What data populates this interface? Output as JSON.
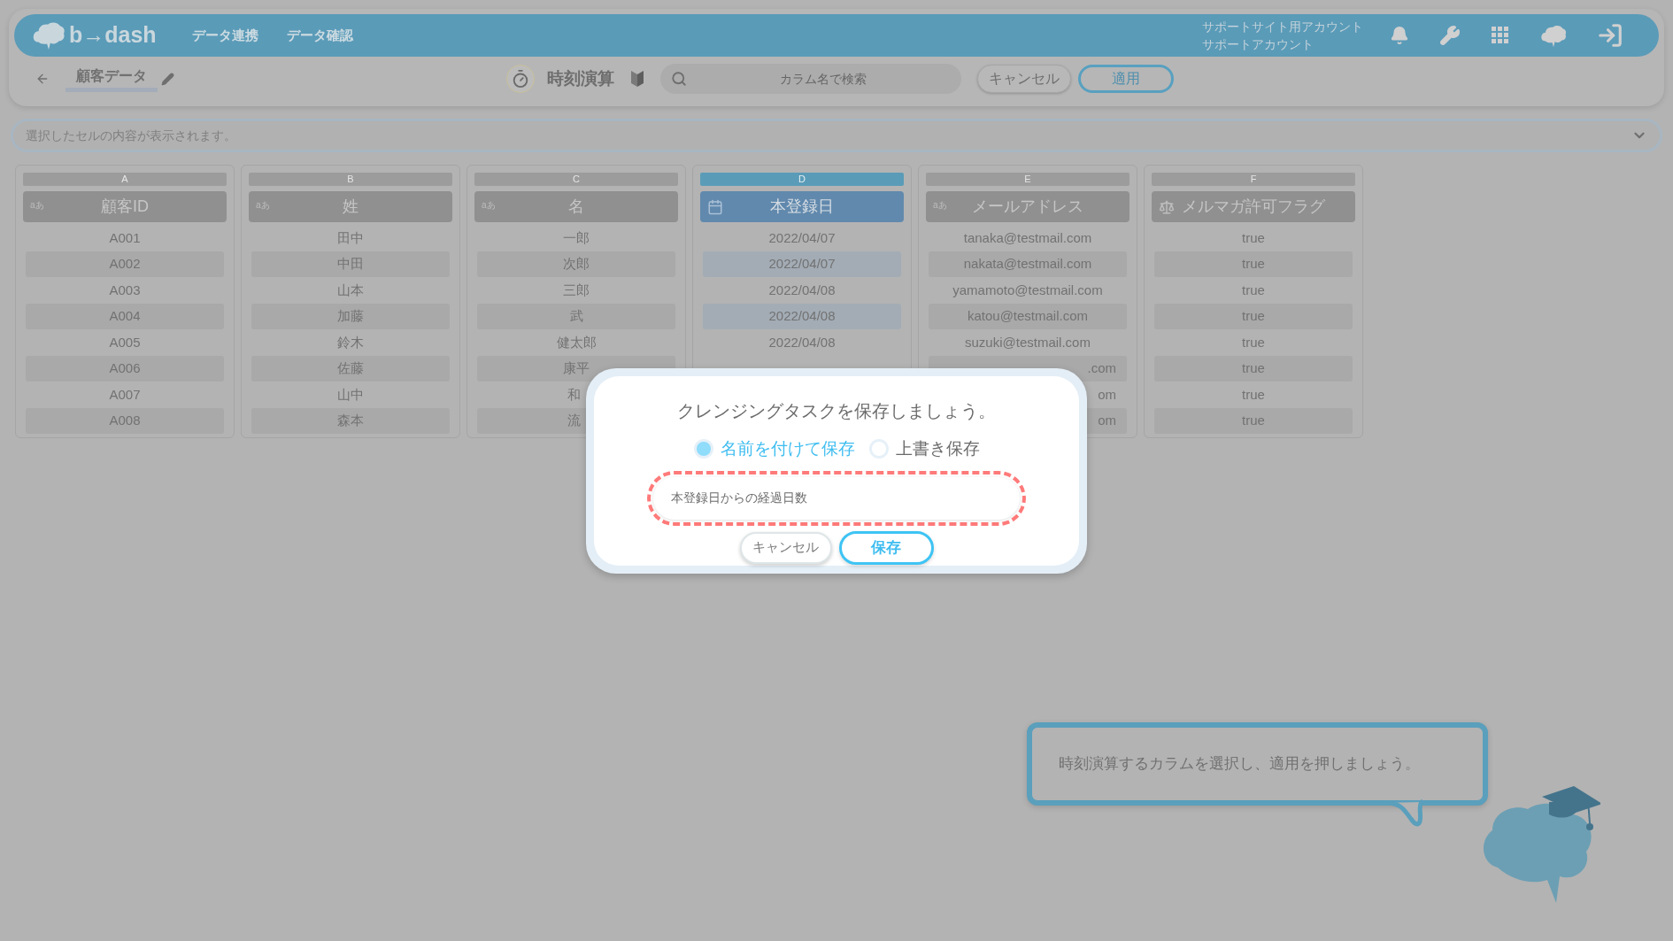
{
  "header": {
    "logo": "b→dash",
    "nav": [
      "データ連携",
      "データ確認"
    ],
    "account": [
      "サポートサイト用アカウント",
      "サポートアカウント"
    ]
  },
  "toolbar": {
    "dataset": "顧客データ",
    "mode": "時刻演算",
    "search": {
      "placeholder": "カラム名で検索"
    },
    "cancel": "キャンセル",
    "apply": "適用"
  },
  "cell_bar": {
    "placeholder": "選択したセルの内容が表示されます。"
  },
  "table": {
    "columns": [
      {
        "letter": "A",
        "name": "顧客ID",
        "kind": "text",
        "type_label": "aあ",
        "selected": false,
        "cells": [
          "A001",
          "A002",
          "A003",
          "A004",
          "A005",
          "A006",
          "A007",
          "A008"
        ]
      },
      {
        "letter": "B",
        "name": "姓",
        "kind": "text",
        "type_label": "aあ",
        "selected": false,
        "cells": [
          "田中",
          "中田",
          "山本",
          "加藤",
          "鈴木",
          "佐藤",
          "山中",
          "森本"
        ]
      },
      {
        "letter": "C",
        "name": "名",
        "kind": "text",
        "type_label": "aあ",
        "selected": false,
        "cells": [
          "一郎",
          "次郎",
          "三郎",
          "武",
          "健太郎",
          "康平",
          {
            "text": "和",
            "kind": "cut_end"
          },
          {
            "text": "流",
            "kind": "cut_end"
          }
        ]
      },
      {
        "letter": "D",
        "name": "本登録日",
        "kind": "date",
        "selected": true,
        "cells": [
          "2022/04/07",
          "2022/04/07",
          "2022/04/08",
          "2022/04/08",
          "2022/04/08"
        ]
      },
      {
        "letter": "E",
        "name": "メールアドレス",
        "kind": "text",
        "type_label": "aあ",
        "selected": false,
        "cells": [
          "tanaka@testmail.com",
          "nakata@testmail.com",
          "yamamoto@testmail.com",
          "katou@testmail.com",
          "suzuki@testmail.com",
          {
            "text": ".com",
            "kind": "cut_start"
          },
          {
            "text": "om",
            "kind": "cut_start"
          },
          {
            "text": "om",
            "kind": "cut_start"
          }
        ]
      },
      {
        "letter": "F",
        "name": "メルマガ許可フラグ",
        "kind": "boolean",
        "selected": false,
        "cells": [
          "true",
          "true",
          "true",
          "true",
          "true",
          "true",
          "true",
          "true"
        ]
      }
    ]
  },
  "dialog": {
    "title": "クレンジングタスクを保存しましょう。",
    "options": [
      {
        "label": "名前を付けて保存",
        "selected": true
      },
      {
        "label": "上書き保存",
        "selected": false
      }
    ],
    "name_field": {
      "value": "本登録日からの経過日数",
      "highlighted": true
    },
    "cancel": "キャンセル",
    "save": "保存"
  },
  "guide": {
    "message": "時刻演算するカラムを選択し、適用を押しましょう。"
  }
}
